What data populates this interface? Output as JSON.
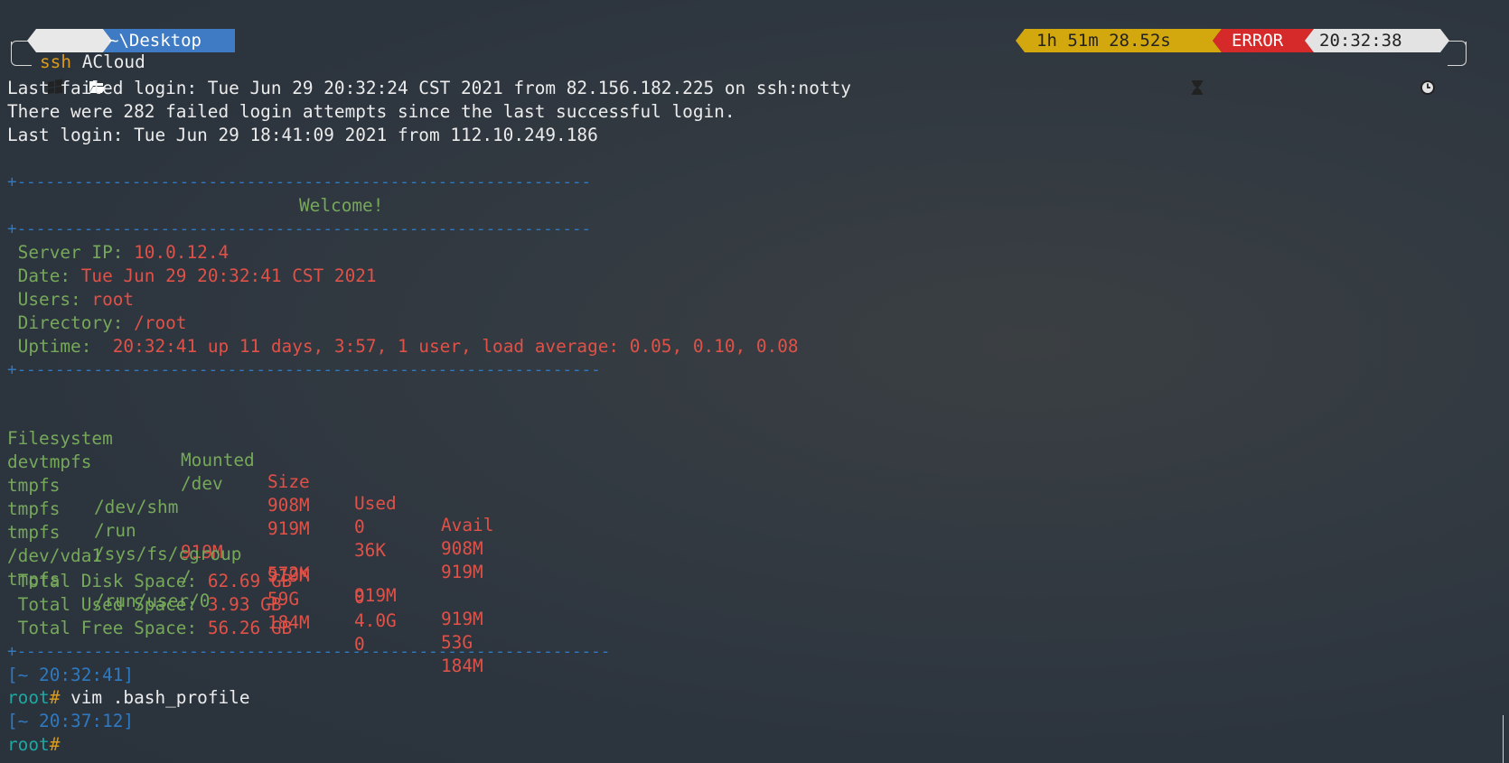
{
  "prompt": {
    "os_icon": "windows-icon",
    "folder_icon": "folder-open-icon",
    "path": "~\\Desktop",
    "duration": "1h 51m 28.52s",
    "duration_icon": "hourglass-icon",
    "status": "ERROR",
    "time": "20:32:38",
    "clock_icon": "clock-icon",
    "command_keyword": "ssh",
    "command_arg": "ACloud",
    "colors": {
      "os_segment": "#e8e8e8",
      "path_segment": "#3e7bc4",
      "duration_segment": "#d3a80f",
      "status_segment": "#d62a2a",
      "time_segment": "#e3e3e3"
    }
  },
  "login": {
    "line1": "Last failed login: Tue Jun 29 20:32:24 CST 2021 from 82.156.182.225 on ssh:notty",
    "line2": "There were 282 failed login attempts since the last successful login.",
    "line3": "Last login: Tue Jun 29 18:41:09 2021 from 112.10.249.186"
  },
  "banner": {
    "rule1": "+------------------------------------------------------------",
    "welcome": "Welcome!",
    "rule2": "+------------------------------------------------------------",
    "rule3": "+-------------------------------------------------------------",
    "rule4": "+--------------------------------------------------------------"
  },
  "info": {
    "server_ip_label": " Server IP: ",
    "server_ip": "10.0.12.4",
    "date_label": " Date: ",
    "date": "Tue Jun 29 20:32:41 CST 2021",
    "users_label": " Users: ",
    "users": "root",
    "directory_label": " Directory: ",
    "directory": "/root",
    "uptime_label": " Uptime:  ",
    "uptime": "20:32:41 up 11 days, 3:57, 1 user, load average: 0.05, 0.10, 0.08"
  },
  "disk": {
    "headers": {
      "filesystem": "Filesystem",
      "mounted": "Mounted",
      "size": "Size",
      "used": "Used",
      "avail": "Avail"
    },
    "rows": [
      {
        "fs": "devtmpfs",
        "mount": "/dev",
        "size": "908M",
        "used": "0",
        "avail": "908M"
      },
      {
        "fs": "tmpfs",
        "mount": "/dev/shm",
        "size": "919M",
        "used": "36K",
        "avail": "919M"
      },
      {
        "fs": "tmpfs",
        "mount": "/run",
        "size": "919M",
        "used": "572K",
        "avail": "919M"
      },
      {
        "fs": "tmpfs",
        "mount": "/sys/fs/cgroup",
        "size": "919M",
        "used": "0",
        "avail": "919M"
      },
      {
        "fs": "/dev/vda1",
        "mount": "/",
        "size": "59G",
        "used": "4.0G",
        "avail": "53G"
      },
      {
        "fs": "tmpfs",
        "mount": "/run/user/0",
        "size": "184M",
        "used": "0",
        "avail": "184M"
      }
    ],
    "total_disk_label": " Total Disk Space: ",
    "total_disk": "62.69 GB",
    "total_used_label": " Total Used Space: ",
    "total_used": "3.93 GB",
    "total_free_label": " Total Free Space: ",
    "total_free": "56.26 GB"
  },
  "session": {
    "stamp1": "[~ 20:32:41]",
    "prompt_user1": "root",
    "prompt_hash1": "#",
    "command1": " vim .bash_profile",
    "stamp2": "[~ 20:37:12]",
    "prompt_user2": "root",
    "prompt_hash2": "#"
  }
}
